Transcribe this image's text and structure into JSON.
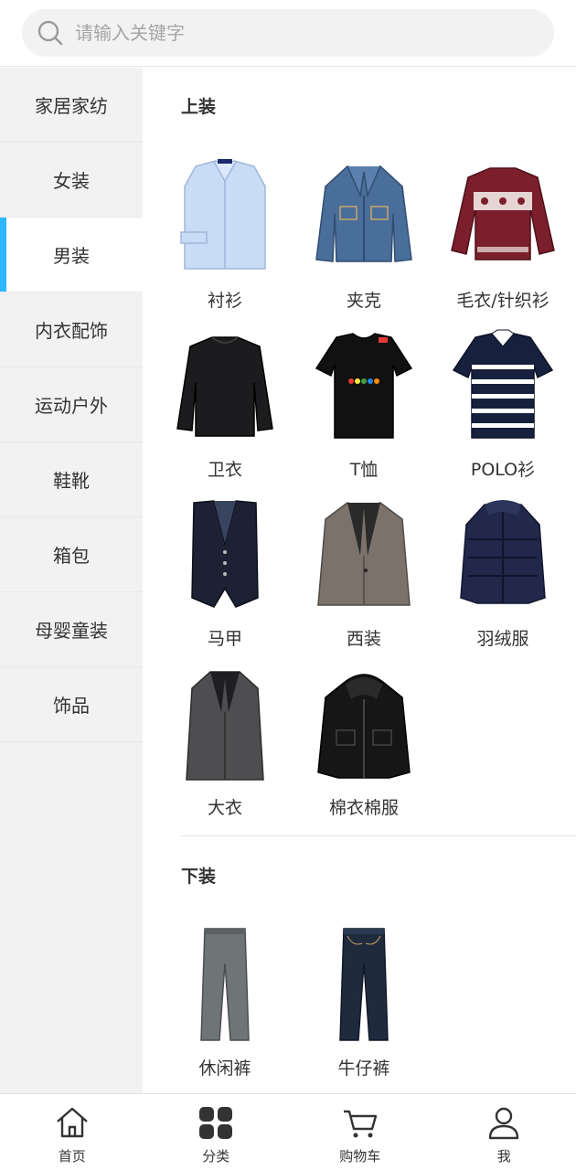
{
  "search": {
    "placeholder": "请输入关键字"
  },
  "sidebar": {
    "items": [
      {
        "label": "家居家纺"
      },
      {
        "label": "女装"
      },
      {
        "label": "男装"
      },
      {
        "label": "内衣配饰"
      },
      {
        "label": "运动户外"
      },
      {
        "label": "鞋靴"
      },
      {
        "label": "箱包"
      },
      {
        "label": "母婴童装"
      },
      {
        "label": "饰品"
      }
    ],
    "active_index": 2,
    "accent_color": "#2cb7ff"
  },
  "sections": [
    {
      "title": "上装",
      "items": [
        {
          "label": "衬衫",
          "icon": "shirt-image"
        },
        {
          "label": "夹克",
          "icon": "denim-jacket-image"
        },
        {
          "label": "毛衣/针织衫",
          "icon": "sweater-image"
        },
        {
          "label": "卫衣",
          "icon": "sweatshirt-image"
        },
        {
          "label": "T恤",
          "icon": "tshirt-image"
        },
        {
          "label": "POLO衫",
          "icon": "polo-image"
        },
        {
          "label": "马甲",
          "icon": "vest-image"
        },
        {
          "label": "西装",
          "icon": "blazer-image"
        },
        {
          "label": "羽绒服",
          "icon": "down-jacket-image"
        },
        {
          "label": "大衣",
          "icon": "overcoat-image"
        },
        {
          "label": "棉衣棉服",
          "icon": "padded-coat-image"
        }
      ]
    },
    {
      "title": "下装",
      "items": [
        {
          "label": "休闲裤",
          "icon": "casual-pants-image"
        },
        {
          "label": "牛仔裤",
          "icon": "jeans-image"
        }
      ]
    }
  ],
  "tabbar": {
    "items": [
      {
        "label": "首页",
        "icon": "home-icon"
      },
      {
        "label": "分类",
        "icon": "category-icon"
      },
      {
        "label": "购物车",
        "icon": "cart-icon"
      },
      {
        "label": "我",
        "icon": "profile-icon"
      }
    ]
  }
}
